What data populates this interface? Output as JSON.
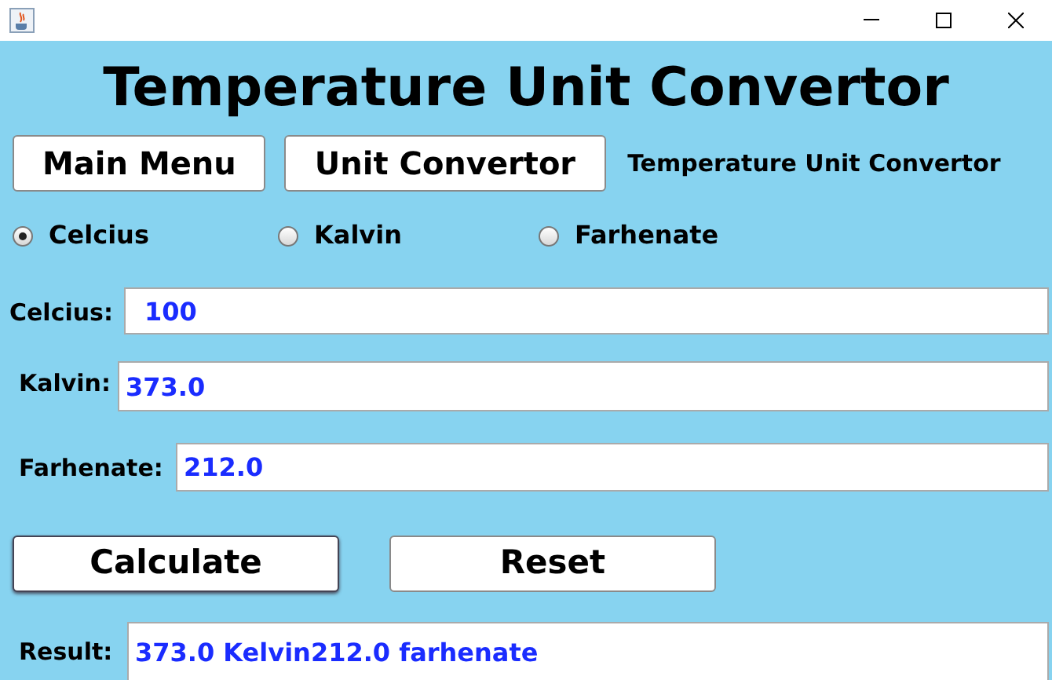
{
  "title": "Temperature Unit Convertor",
  "nav_buttons": [
    "Main Menu",
    "Unit Convertor"
  ],
  "nav_label": "Temperature Unit Convertor",
  "units": [
    {
      "label": "Celcius",
      "selected": true
    },
    {
      "label": "Kalvin",
      "selected": false
    },
    {
      "label": "Farhenate",
      "selected": false
    }
  ],
  "fields": [
    {
      "label": "Celcius:",
      "value": "100"
    },
    {
      "label": "Kalvin:",
      "value": "373.0"
    },
    {
      "label": "Farhenate:",
      "value": "212.0"
    }
  ],
  "actions": [
    {
      "label": "Calculate",
      "focused": true
    },
    {
      "label": "Reset",
      "focused": false
    }
  ],
  "result": {
    "label": "Result:",
    "value": "373.0 Kelvin212.0 farhenate"
  }
}
